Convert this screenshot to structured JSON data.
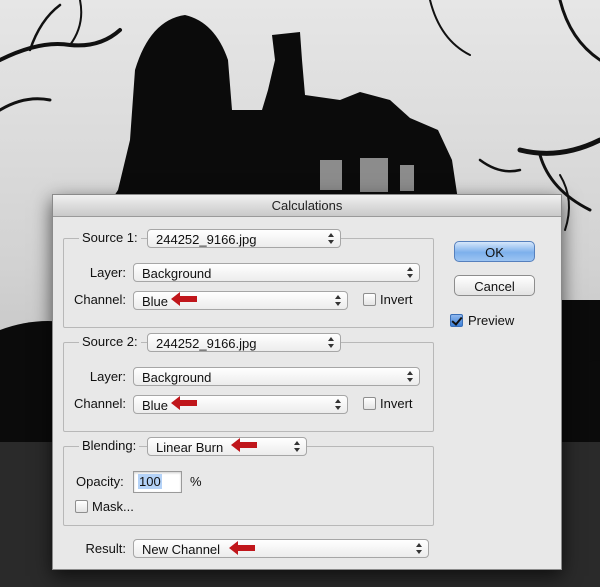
{
  "dialog": {
    "title": "Calculations",
    "source1": {
      "legend": "Source 1:",
      "file": "244252_9166.jpg",
      "layer_label": "Layer:",
      "layer": "Background",
      "channel_label": "Channel:",
      "channel": "Blue",
      "invert_label": "Invert",
      "invert_checked": false
    },
    "source2": {
      "legend": "Source 2:",
      "file": "244252_9166.jpg",
      "layer_label": "Layer:",
      "layer": "Background",
      "channel_label": "Channel:",
      "channel": "Blue",
      "invert_label": "Invert",
      "invert_checked": false
    },
    "blending": {
      "legend": "Blending:",
      "mode": "Linear Burn",
      "opacity_label": "Opacity:",
      "opacity": "100",
      "opacity_unit": "%",
      "mask_label": "Mask...",
      "mask_checked": false
    },
    "result": {
      "label": "Result:",
      "value": "New Channel"
    },
    "buttons": {
      "ok": "OK",
      "cancel": "Cancel"
    },
    "preview": {
      "label": "Preview",
      "checked": true
    }
  },
  "annotation_color": "#c0161b",
  "icons": [
    "updown-arrows-icon",
    "red-arrow-icon",
    "checkmark-icon"
  ]
}
